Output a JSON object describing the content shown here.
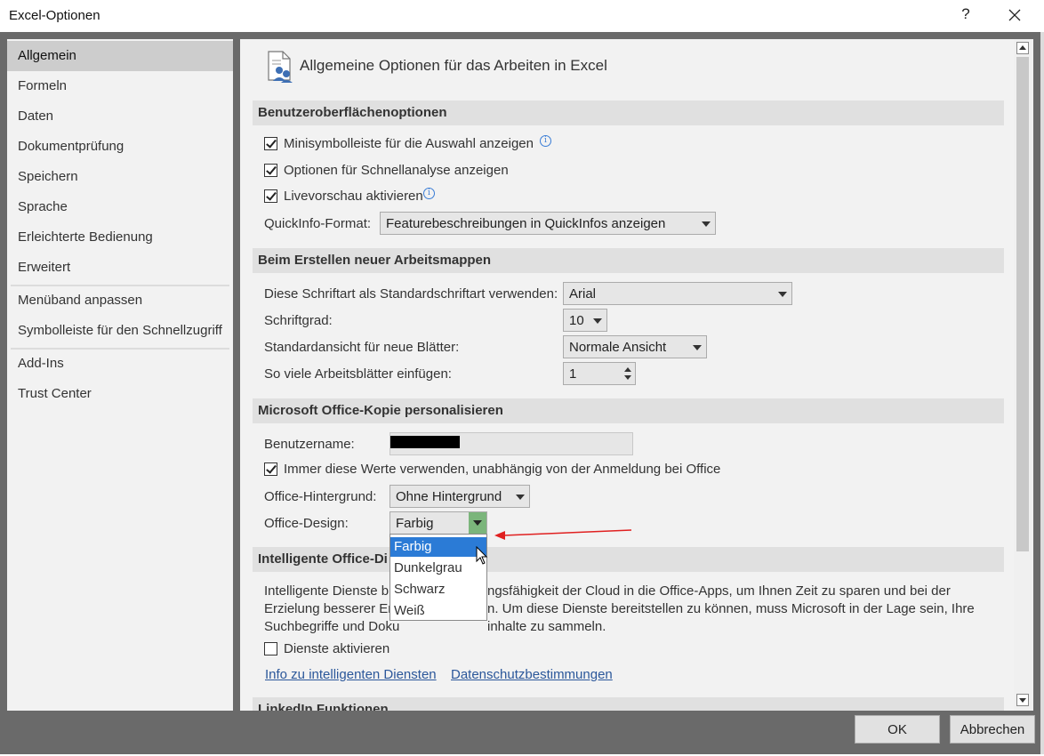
{
  "window": {
    "title": "Excel-Optionen",
    "help": "?"
  },
  "sidebar": {
    "items": [
      {
        "label": "Allgemein"
      },
      {
        "label": "Formeln"
      },
      {
        "label": "Daten"
      },
      {
        "label": "Dokumentprüfung"
      },
      {
        "label": "Speichern"
      },
      {
        "label": "Sprache"
      },
      {
        "label": "Erleichterte Bedienung"
      },
      {
        "label": "Erweitert"
      },
      {
        "label": "Menüband anpassen"
      },
      {
        "label": "Symbolleiste für den Schnellzugriff"
      },
      {
        "label": "Add-Ins"
      },
      {
        "label": "Trust Center"
      }
    ]
  },
  "page": {
    "title": "Allgemeine Optionen für das Arbeiten in Excel"
  },
  "ui_options": {
    "header": "Benutzeroberflächenoptionen",
    "mini_toolbar": "Minisymbolleiste für die Auswahl anzeigen",
    "quick_analysis": "Optionen für Schnellanalyse anzeigen",
    "live_preview": "Livevorschau aktivieren",
    "screentip_label": "QuickInfo-Format:",
    "screentip_value": "Featurebeschreibungen in QuickInfos anzeigen"
  },
  "new_workbooks": {
    "header": "Beim Erstellen neuer Arbeitsmappen",
    "font_label": "Diese Schriftart als Standardschriftart verwenden:",
    "font_value": "Arial",
    "size_label": "Schriftgrad:",
    "size_value": "10",
    "view_label": "Standardansicht für neue Blätter:",
    "view_value": "Normale Ansicht",
    "sheets_label": "So viele Arbeitsblätter einfügen:",
    "sheets_value": "1"
  },
  "personalize": {
    "header": "Microsoft Office-Kopie personalisieren",
    "username_label": "Benutzername:",
    "always_use": "Immer diese Werte verwenden, unabhängig von der Anmeldung bei Office",
    "background_label": "Office-Hintergrund:",
    "background_value": "Ohne Hintergrund",
    "theme_label": "Office-Design:",
    "theme_value": "Farbig",
    "theme_options": [
      "Farbig",
      "Dunkelgrau",
      "Schwarz",
      "Weiß"
    ]
  },
  "intelligent": {
    "header": "Intelligente Office-Di",
    "text_l1": "Intelligente Dienste b",
    "text_l1b": "ngsfähigkeit der Cloud in die Office-Apps, um Ihnen Zeit zu sparen und bei der",
    "text_l2": "Erzielung besserer Er",
    "text_l2b": "n. Um diese Dienste bereitstellen zu können, muss Microsoft in der Lage sein, Ihre",
    "text_l3": "Suchbegriffe und Doku",
    "text_l3b": "inhalte zu sammeln.",
    "enable": "Dienste aktivieren",
    "link_info": "Info zu intelligenten Diensten",
    "link_privacy": "Datenschutzbestimmungen"
  },
  "linkedin": {
    "header": "LinkedIn Funktionen"
  },
  "footer": {
    "ok": "OK",
    "cancel": "Abbrechen"
  },
  "colors": {
    "accent": "#2b7bd6",
    "dropdown_active": "#7bb57b",
    "annotation": "#e02020"
  }
}
